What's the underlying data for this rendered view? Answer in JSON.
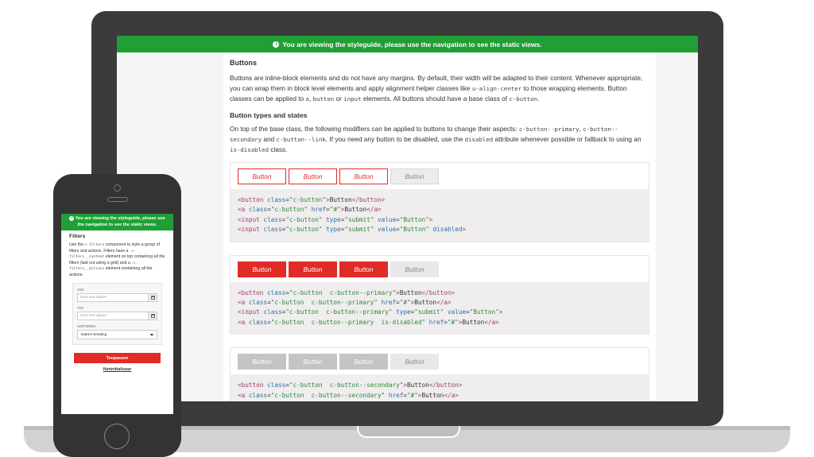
{
  "desktop": {
    "notice": "You are viewing the styleguide, please use the navigation to see the static views.",
    "section_title": "Buttons",
    "intro": {
      "t1": "Buttons are inline-block elements and do not have any margins. By default, their width will be adapted to their content. Whenever appropriate, you can wrap them in block level elements and apply alignment helper classes like ",
      "c1": "u-align-center",
      "t2": " to those wrapping elements. Button classes can be applied to ",
      "c2": "a",
      "t3": ", ",
      "c3": "button",
      "t4": " or ",
      "c4": "input",
      "t5": " elements. All buttons should have a base class of ",
      "c5": "c-button",
      "t6": "."
    },
    "subsection_title": "Button types and states",
    "states": {
      "t1": "On top of the base class, the following modifiers can be applied to buttons to change their aspects: ",
      "c1": "c-button--primary",
      "t2": ", ",
      "c2": "c-button--secondary",
      "t3": " and ",
      "c3": "c-button--link",
      "t4": ". If you need any button to be disabled, use the ",
      "c4": "disabled",
      "t5": " attribute whenever possible or fallback to using an ",
      "c5": "is-disabled",
      "t6": " class."
    },
    "button_label": "Button",
    "code": {
      "tag_button": "button",
      "tag_a": "a",
      "tag_input": "input",
      "attr_class": "class",
      "attr_href": "href",
      "attr_type": "type",
      "attr_value": "value",
      "val_cbutton": "\"c-button\"",
      "val_primary": "\"c-button  c-button--primary\"",
      "val_primary_disabled": "\"c-button  c-button--primary  is-disabled\"",
      "val_secondary": "\"c-button  c-button--secondary\"",
      "val_href": "\"#\"",
      "val_submit": "\"submit\"",
      "val_button": "\"Button\"",
      "disabled": "disabled",
      "text": "Button"
    }
  },
  "mobile": {
    "notice": "You are viewing the styleguide, please use the navigation to see the static views.",
    "title": "Filters",
    "para": {
      "t1": "Use the ",
      "c1": "c-filters",
      "t2": " component to style a group of filters and actions. Filters have a ",
      "c2": ".c-filters__content",
      "t3": " element on top containing all the filters (laid out using a grid) and a ",
      "c3": ".c-filters__actions",
      "t4": " element containing all the actions."
    },
    "from_label": "VAN",
    "from_placeholder": "Kies een datum",
    "to_label": "TOT",
    "to_placeholder": "Kies een datum",
    "sort_label": "SORTEREN",
    "sort_value": "Datum betaling",
    "apply_label": "Toepassen",
    "reset_label": "Herinitialiseer"
  },
  "colors": {
    "notice_green": "#1f9f35",
    "button_red": "#e02b27",
    "device_dark": "#3b3b3b"
  }
}
